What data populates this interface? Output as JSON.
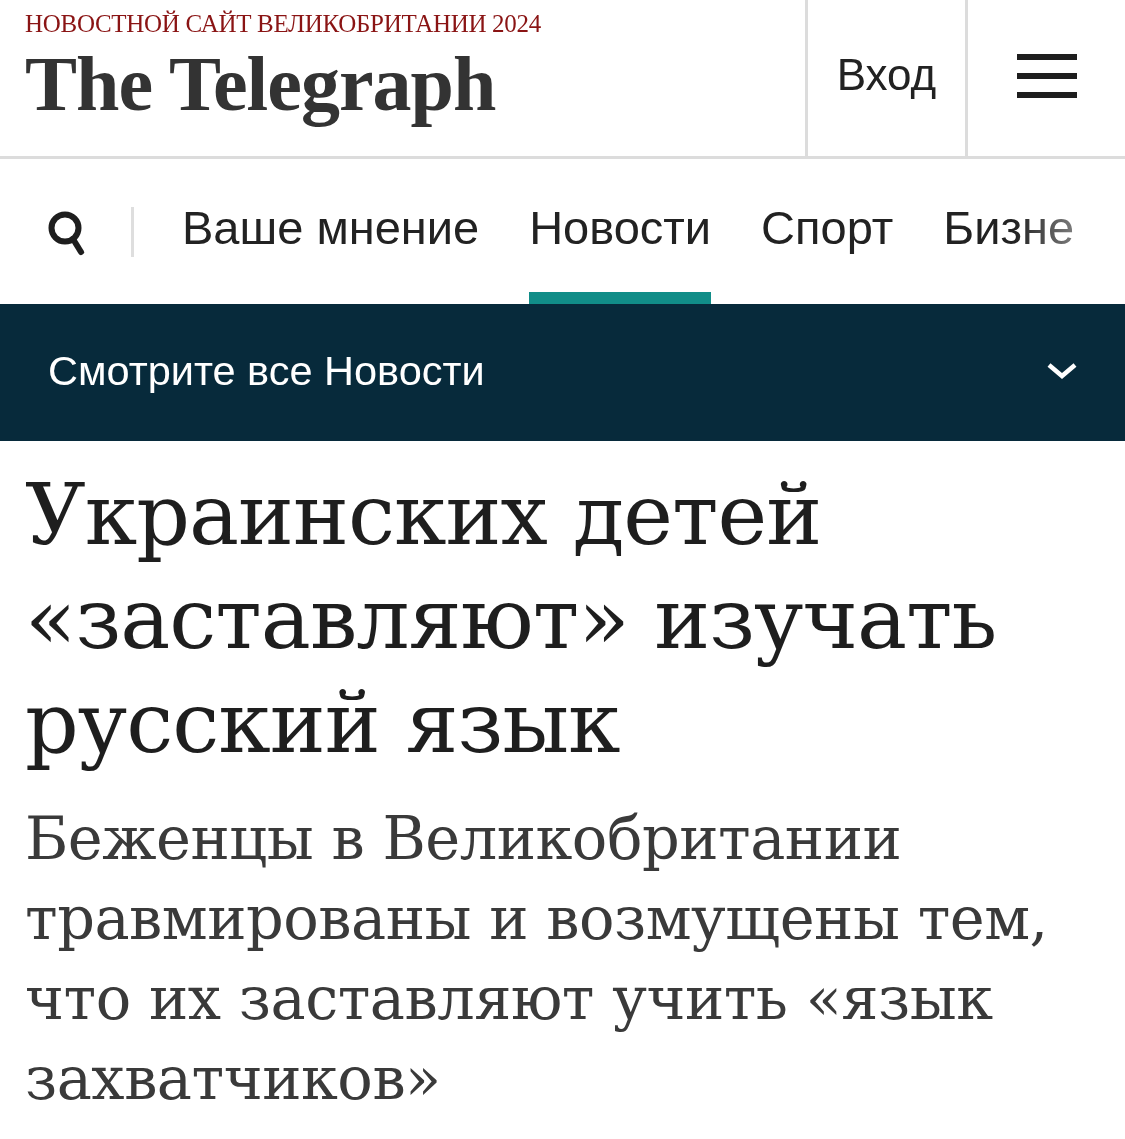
{
  "masthead": {
    "tagline": "НОВОСТНОЙ САЙТ ВЕЛИКОБРИТАНИИ 2024",
    "logo": "The Telegraph",
    "login": "Вход"
  },
  "nav": {
    "items": [
      {
        "label": "Ваше мнение",
        "selected": false
      },
      {
        "label": "Новости",
        "selected": true
      },
      {
        "label": "Спорт",
        "selected": false
      },
      {
        "label": "Бизне",
        "selected": false
      }
    ]
  },
  "section_bar": {
    "label": "Смотрите все Новости",
    "expanded": false
  },
  "article": {
    "headline": "Украинских детей «заставляют» изучать русский язык",
    "standfirst": "Беженцы в Великобритании травмированы и возмущены тем, что их заставляют учить «язык захватчиков»"
  }
}
